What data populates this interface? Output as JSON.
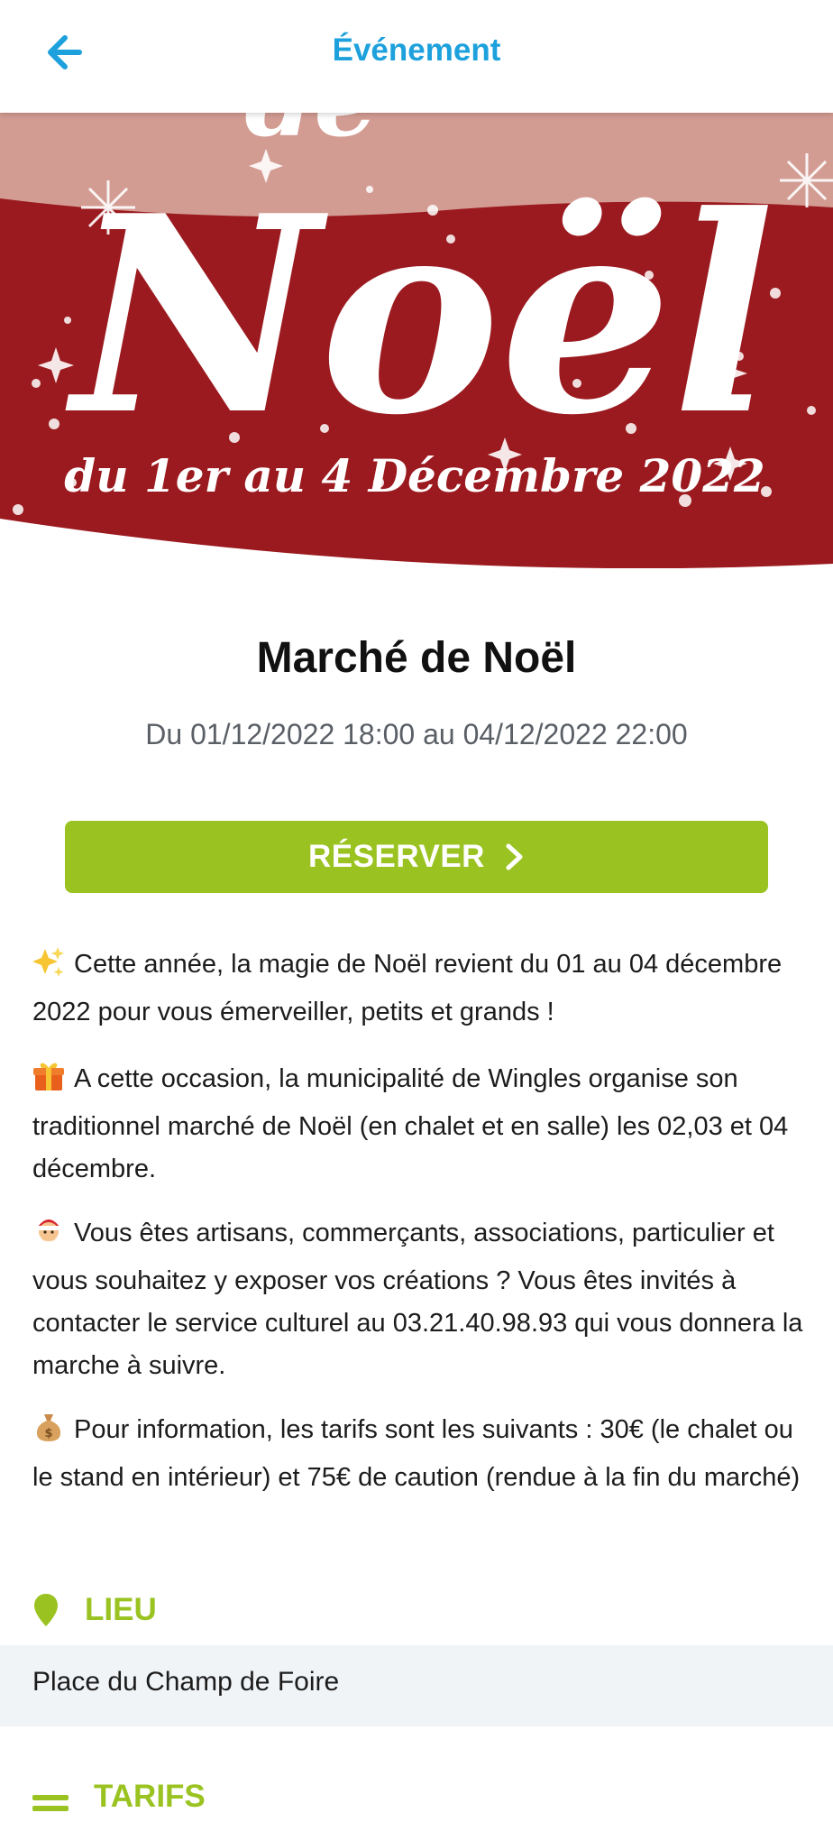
{
  "header": {
    "title": "Événement",
    "back_icon": "arrow-left-icon"
  },
  "banner": {
    "text_big": "Noël",
    "text_top": "de",
    "text_dates": "du 1er au 4 Décembre 2022",
    "bg_color": "#9b1a1f"
  },
  "event": {
    "title": "Marché de Noël",
    "dates": "Du 01/12/2022 18:00 au 04/12/2022 22:00",
    "reserve_label": "RÉSERVER"
  },
  "description": [
    {
      "icon": "sparkles-icon",
      "text": "Cette année, la magie de Noël revient du 01 au 04 décembre 2022 pour vous émerveiller, petits et grands !"
    },
    {
      "icon": "gift-icon",
      "text": "A cette occasion, la municipalité de Wingles organise son traditionnel marché de Noël (en chalet et en salle) les 02,03 et 04 décembre."
    },
    {
      "icon": "santa-icon",
      "text": "Vous êtes artisans, commerçants, associations, particulier et vous souhaitez y exposer vos créations ? Vous êtes invités à contacter le service culturel au 03.21.40.98.93 qui vous donnera la marche à suivre."
    },
    {
      "icon": "money-bag-icon",
      "text": "Pour information, les tarifs sont les suivants : 30€ (le chalet ou le stand en intérieur) et 75€ de caution (rendue à la fin du marché)"
    }
  ],
  "lieu": {
    "label": "LIEU",
    "value": "Place du Champ de Foire"
  },
  "tarifs": {
    "label": "TARIFS"
  },
  "colors": {
    "accent_blue": "#1da1dc",
    "accent_green": "#9ac321",
    "banner_red": "#9b1a1f"
  }
}
